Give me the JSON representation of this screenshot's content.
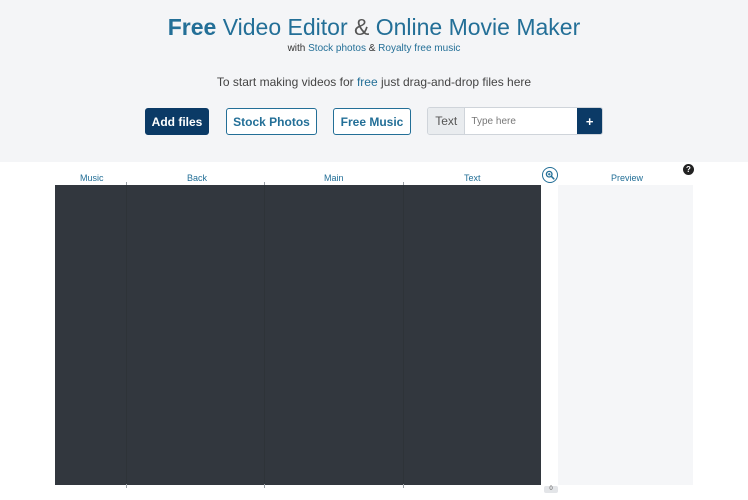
{
  "header": {
    "title_free": "Free",
    "title_video_editor": " Video Editor ",
    "title_amp": "&",
    "title_movie_maker": " Online Movie Maker",
    "subtitle_with": "with ",
    "subtitle_stock": "Stock photos",
    "subtitle_and": " & ",
    "subtitle_music": "Royalty free music",
    "hint_before": "To start making videos for ",
    "hint_free": "free",
    "hint_after": " just drag-and-drop files here"
  },
  "toolbar": {
    "add_files": "Add files",
    "stock_photos": "Stock Photos",
    "free_music": "Free Music",
    "text_label": "Text",
    "text_placeholder": "Type here",
    "plus": "+"
  },
  "timeline": {
    "columns": [
      "Music",
      "Back",
      "Main",
      "Text"
    ],
    "preview_label": "Preview",
    "zoom_icon": "zoom-in-icon",
    "help_icon": "question-icon",
    "help_glyph": "?",
    "scroll_badge": "0"
  },
  "colors": {
    "accent": "#236f97",
    "primary_button": "#0b3a66",
    "timeline_bg": "#32373e",
    "header_bg": "#f4f5f7"
  }
}
